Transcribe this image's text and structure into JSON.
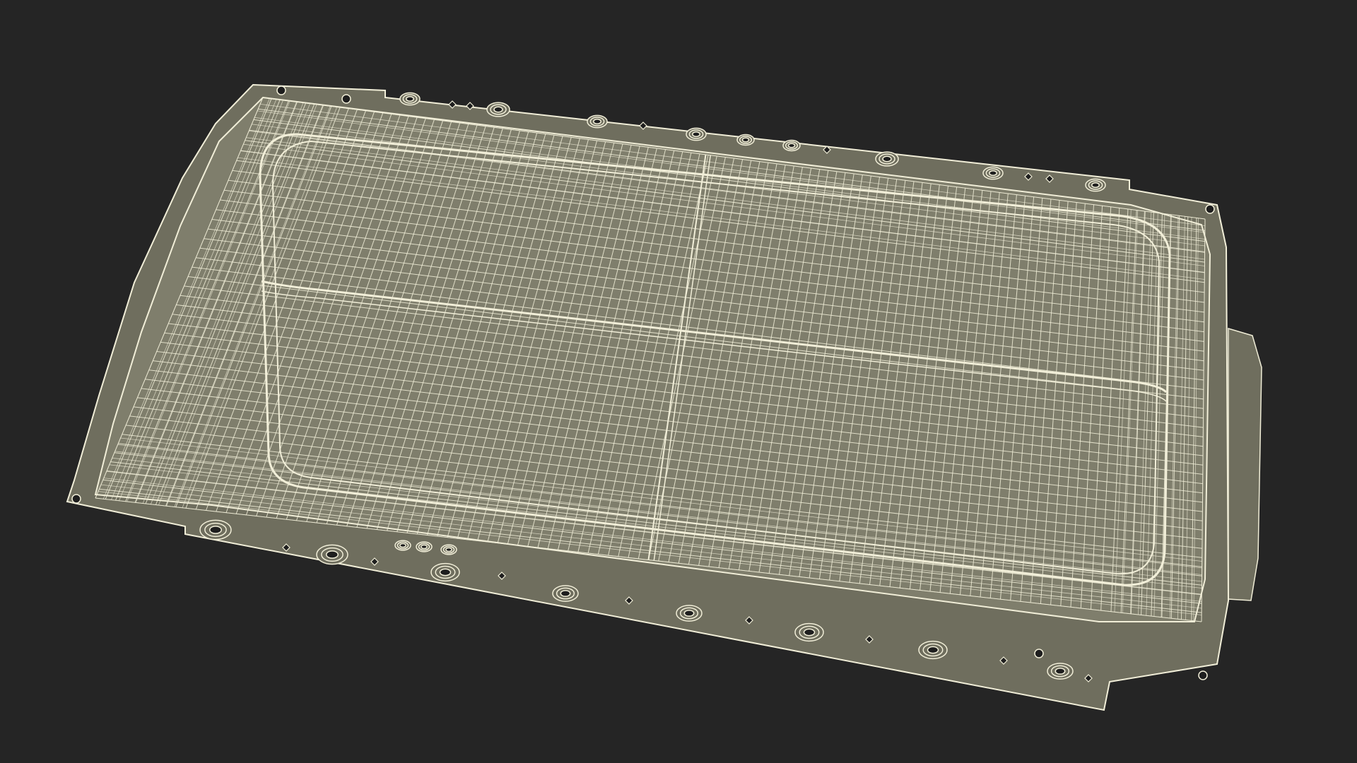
{
  "scene": {
    "subject": "battery-tray-wireframe",
    "colors": {
      "background": "#252525",
      "surface": "#7f7e6c",
      "surface_dark": "#6f6e5e",
      "wire": "#f1eed8",
      "hole": "#1e1e1e"
    }
  }
}
